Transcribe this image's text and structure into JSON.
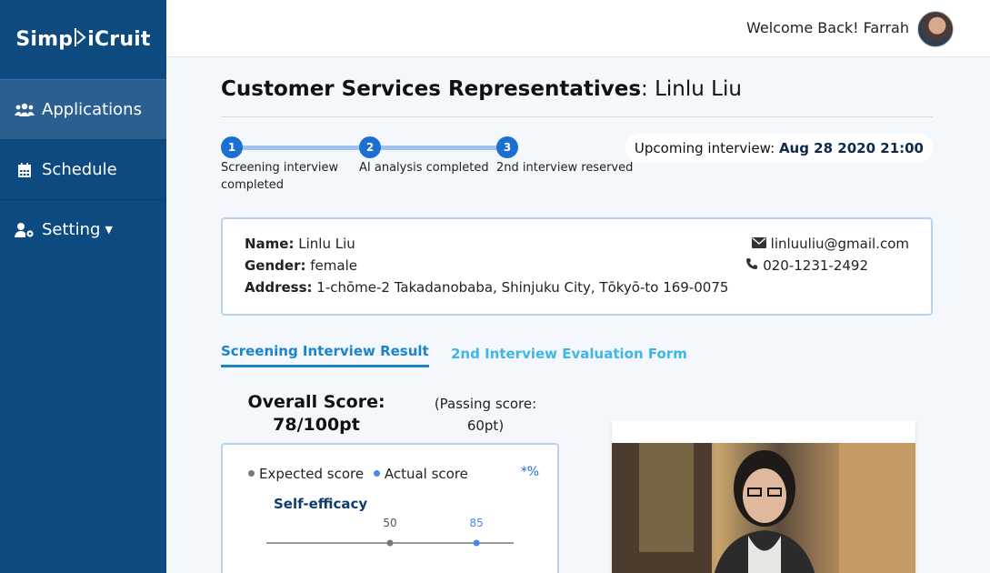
{
  "brand": {
    "name_left": "Simp",
    "name_right": "iCruit"
  },
  "sidebar": {
    "items": [
      {
        "label": "Applications",
        "icon": "users-icon",
        "active": true
      },
      {
        "label": "Schedule",
        "icon": "calendar-icon",
        "active": false
      },
      {
        "label": "Setting",
        "icon": "user-gear-icon",
        "active": false
      }
    ]
  },
  "header": {
    "welcome": "Welcome Back! Farrah"
  },
  "page": {
    "title_bold": "Customer Services Representatives",
    "title_rest": ": Linlu Liu"
  },
  "progress": {
    "steps": [
      {
        "num": "1",
        "label": "Screening interview completed"
      },
      {
        "num": "2",
        "label": "AI analysis completed"
      },
      {
        "num": "3",
        "label": "2nd interview reserved"
      }
    ],
    "upcoming_label": "Upcoming interview:",
    "upcoming_value": "Aug 28 2020 21:00"
  },
  "candidate": {
    "name_label": "Name:",
    "name": "Linlu Liu",
    "gender_label": "Gender:",
    "gender": "female",
    "address_label": "Address:",
    "address": "1-chōme-2 Takadanobaba, Shinjuku City, Tōkyō-to 169-0075",
    "email": "linluuliu@gmail.com",
    "phone": "020-1231-2492"
  },
  "tabs": [
    {
      "label": "Screening Interview Result",
      "active": true
    },
    {
      "label": "2nd Interview Evaluation Form",
      "active": false
    }
  ],
  "result": {
    "overall_line1": "Overall Score:",
    "overall_line2": "78/100pt",
    "passing_line1": "(Passing score:",
    "passing_line2": "60pt)"
  },
  "chart_data": {
    "type": "scatter",
    "legend": [
      "Expected score",
      "Actual score"
    ],
    "unit_label": "*%",
    "metrics": [
      {
        "name": "Self-efficacy",
        "expected": 50,
        "actual": 85
      }
    ],
    "xlim": [
      0,
      100
    ],
    "colors": {
      "expected": "#777777",
      "actual": "#4a86e8"
    }
  },
  "colors": {
    "sidebar": "#0c4a80",
    "accent": "#1a6fd1",
    "tab_active": "#1a86c9"
  }
}
